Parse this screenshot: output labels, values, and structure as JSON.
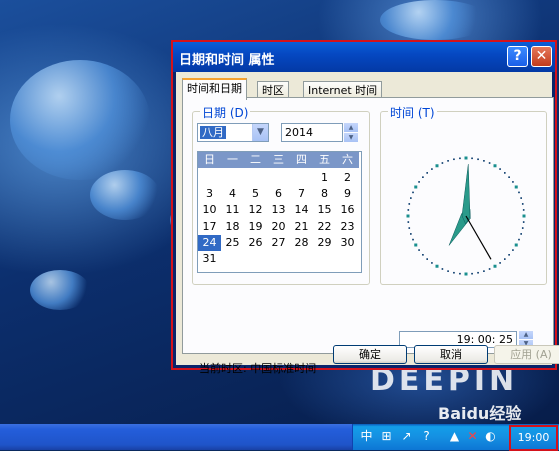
{
  "dialog": {
    "title": "日期和时间 属性",
    "help_glyph": "?",
    "close_glyph": "✕",
    "tabs": [
      {
        "label": "时间和日期"
      },
      {
        "label": "时区"
      },
      {
        "label": "Internet 时间"
      }
    ],
    "date_group_label": "日期 (D)",
    "time_group_label": "时间 (T)",
    "month_value": "八月",
    "year_value": "2014",
    "calendar": {
      "weekdays": [
        "日",
        "一",
        "二",
        "三",
        "四",
        "五",
        "六"
      ],
      "rows": [
        [
          "",
          "",
          "",
          "",
          "",
          "1",
          "2"
        ],
        [
          "3",
          "4",
          "5",
          "6",
          "7",
          "8",
          "9"
        ],
        [
          "10",
          "11",
          "12",
          "13",
          "14",
          "15",
          "16"
        ],
        [
          "17",
          "18",
          "19",
          "20",
          "21",
          "22",
          "23"
        ],
        [
          "24",
          "25",
          "26",
          "27",
          "28",
          "29",
          "30"
        ],
        [
          "31",
          "",
          "",
          "",
          "",
          "",
          ""
        ]
      ],
      "selected_day": "24"
    },
    "clock": {
      "hour": 19,
      "minute": 0,
      "second": 25
    },
    "time_value": "19: 00: 25",
    "timezone_line": "当前时区: 中国标准时间",
    "buttons": {
      "ok": "确定",
      "cancel": "取消",
      "apply": "应用 (A)"
    }
  },
  "desktop": {
    "watermark": "DEEPIN"
  },
  "taskbar": {
    "tray_icons": [
      "中",
      "⊞",
      "↗",
      "?",
      "▲",
      "✕",
      "◐"
    ],
    "clock": "19:00"
  },
  "overlay": {
    "baidu": "Baidu经验"
  },
  "colors": {
    "selection": "#316ac5",
    "highlight_border": "#d4121b",
    "title_blue": "#0548c2",
    "group_label": "#0046d5"
  }
}
